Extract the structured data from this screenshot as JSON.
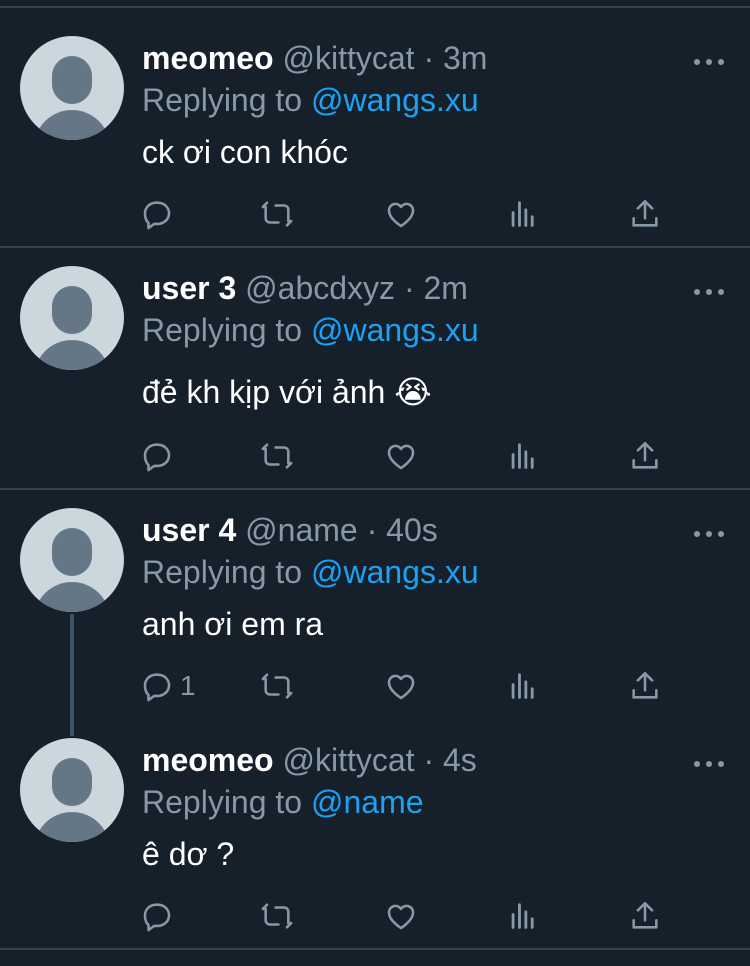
{
  "tweets": [
    {
      "name": "meomeo",
      "handle": "@kittycat",
      "time": "3m",
      "replying_prefix": "Replying to",
      "replying_to": "@wangs.xu",
      "text": "ck ơi con khóc",
      "reply_count": ""
    },
    {
      "name": "user 3",
      "handle": "@abcdxyz",
      "time": "2m",
      "replying_prefix": "Replying to",
      "replying_to": "@wangs.xu",
      "text": "đẻ kh kịp với ảnh 😭",
      "reply_count": ""
    },
    {
      "name": "user 4",
      "handle": "@name",
      "time": "40s",
      "replying_prefix": "Replying to",
      "replying_to": "@wangs.xu",
      "text": "anh ơi em ra",
      "reply_count": "1"
    },
    {
      "name": "meomeo",
      "handle": "@kittycat",
      "time": "4s",
      "replying_prefix": "Replying to",
      "replying_to": "@name",
      "text": "ê dơ ?",
      "reply_count": ""
    }
  ],
  "separator": "·",
  "icons": [
    "more-icon",
    "reply-icon",
    "retweet-icon",
    "like-icon",
    "analytics-icon",
    "share-icon"
  ],
  "colors": {
    "background": "#15202b",
    "text": "#ffffff",
    "secondary": "#8899a6",
    "link": "#1da1f2",
    "divider": "#38444d"
  }
}
